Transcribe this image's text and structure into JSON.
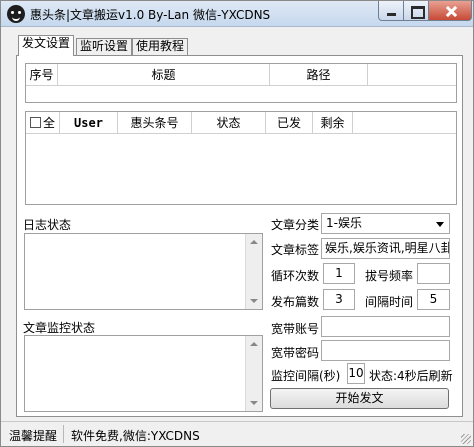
{
  "window": {
    "title": "惠头条|文章搬运v1.0 By-Lan 微信-YXCDNS"
  },
  "tabs": [
    {
      "label": "发文设置",
      "active": true
    },
    {
      "label": "监听设置",
      "active": false
    },
    {
      "label": "使用教程",
      "active": false
    }
  ],
  "path_table": {
    "columns": [
      "序号",
      "标题",
      "路径"
    ]
  },
  "account_table": {
    "select_all_label": "全",
    "columns": [
      "User",
      "惠头条号",
      "状态",
      "已发",
      "剩余"
    ]
  },
  "log": {
    "label": "日志状态"
  },
  "monitor_log": {
    "label": "文章监控状态"
  },
  "form": {
    "category_label": "文章分类",
    "category_value": "1-娱乐",
    "tags_label": "文章标签",
    "tags_value": "娱乐,娱乐资讯,明星八卦",
    "loop_label": "循环次数",
    "loop_value": "1",
    "dial_label": "拔号频率",
    "dial_value": "",
    "publish_label": "发布篇数",
    "publish_value": "3",
    "interval_label": "间隔时间",
    "interval_value": "5",
    "broadband_account_label": "宽带账号",
    "broadband_account_value": "",
    "broadband_password_label": "宽带密码",
    "broadband_password_value": "",
    "monitor_interval_label": "监控间隔(秒)",
    "monitor_interval_value": "10",
    "status_text": "状态:4秒后刷新",
    "start_button_label": "开始发文"
  },
  "statusbar": {
    "tip_label": "温馨提醒",
    "message": "软件免费,微信:YXCDNS"
  }
}
